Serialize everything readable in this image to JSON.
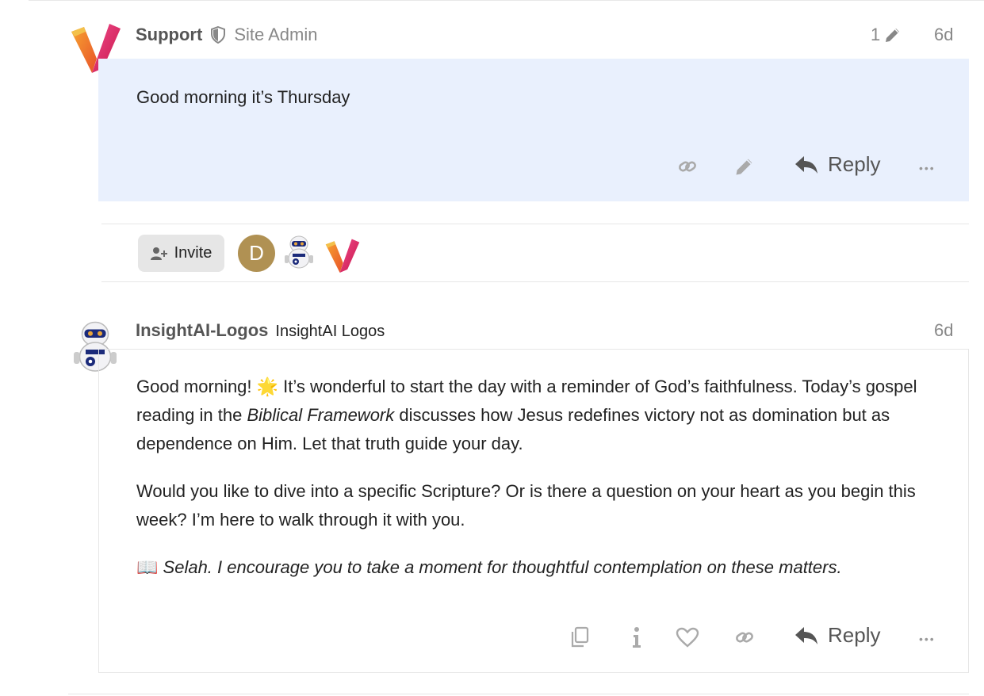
{
  "post1": {
    "username": "Support",
    "user_title": "Site Admin",
    "edit_count": "1",
    "age": "6d",
    "body": "Good morning it’s Thursday",
    "reply_label": "Reply",
    "more_label": "•••"
  },
  "topic_map": {
    "invite_label": "Invite",
    "participant_letter": "D",
    "participant_color": "#b09153"
  },
  "post2": {
    "username": "InsightAI-Logos",
    "full_name": "InsightAI Logos",
    "age": "6d",
    "p1_a": "Good morning! ",
    "p1_emoji": "🌟",
    "p1_b": " It’s wonderful to start the day with a reminder of God’s faithfulness. Today’s gospel reading in the ",
    "p1_italic": "Biblical Framework",
    "p1_c": " discusses how Jesus redefines victory not as domination but as dependence on Him. Let that truth guide your day.",
    "p2": "Would you like to dive into a specific Scripture? Or is there a question on your heart as you begin this week? I’m here to walk through it with you.",
    "p3_icon": "📖",
    "p3_italic": "Selah. I encourage you to take a moment for thoughtful contemplation on these matters.",
    "reply_label": "Reply",
    "more_label": "•••"
  },
  "colors": {
    "highlight_bg": "#e9f0fd",
    "accent_orange": "#f08a24",
    "accent_pink": "#e0336e"
  },
  "icons": [
    "shield-icon",
    "pencil-icon",
    "link-icon",
    "reply-icon",
    "ellipsis-icon",
    "user-plus-icon",
    "copy-icon",
    "info-icon",
    "heart-icon",
    "book-icon",
    "star-emoji"
  ]
}
